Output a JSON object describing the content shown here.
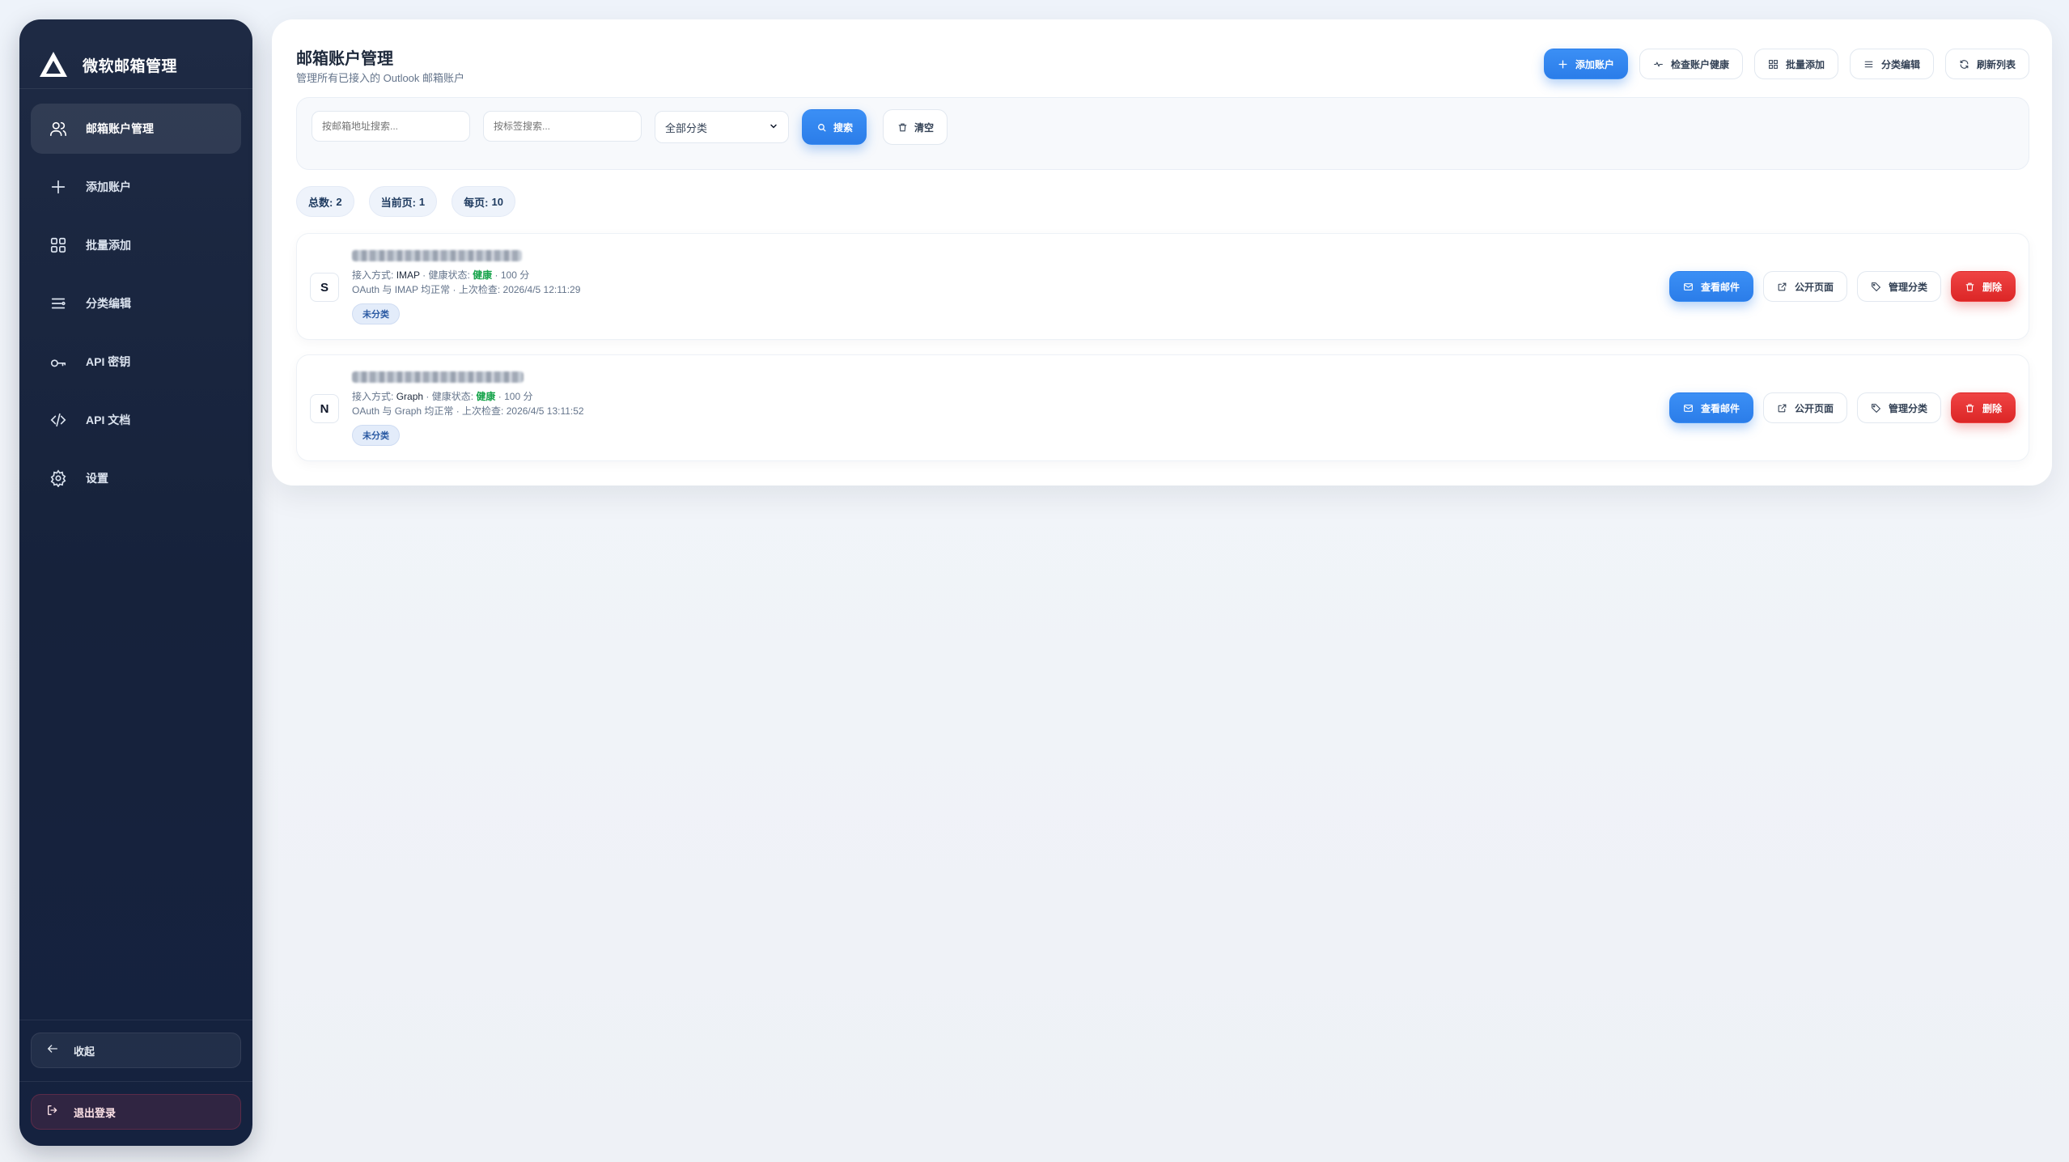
{
  "colors": {
    "accent": "#2b7de9",
    "danger": "#dc2626",
    "sidebar": "#1a2640",
    "healthy": "#16a34a"
  },
  "sidebar": {
    "brand": "微软邮箱管理",
    "items": [
      {
        "label": "邮箱账户管理",
        "icon": "users-icon",
        "active": true
      },
      {
        "label": "添加账户",
        "icon": "plus-icon"
      },
      {
        "label": "批量添加",
        "icon": "grid-icon"
      },
      {
        "label": "分类编辑",
        "icon": "list-icon"
      },
      {
        "label": "API 密钥",
        "icon": "key-icon"
      },
      {
        "label": "API 文档",
        "icon": "code-icon"
      },
      {
        "label": "设置",
        "icon": "gear-icon"
      }
    ],
    "collapse": "收起",
    "logout": "退出登录"
  },
  "header": {
    "title": "邮箱账户管理",
    "subtitle": "管理所有已接入的 Outlook 邮箱账户",
    "actions": {
      "add": "添加账户",
      "check": "检查账户健康",
      "batch": "批量添加",
      "category": "分类编辑",
      "refresh": "刷新列表"
    }
  },
  "filters": {
    "email_placeholder": "按邮箱地址搜索...",
    "tag_placeholder": "按标签搜索...",
    "category_selected": "全部分类",
    "search": "搜索",
    "clear": "清空"
  },
  "stats": {
    "total_label": "总数:",
    "total": "2",
    "page_label": "当前页:",
    "page": "1",
    "per_page_label": "每页:",
    "per_page": "10"
  },
  "accounts": [
    {
      "initial": "S",
      "method_label": "接入方式:",
      "method": "IMAP",
      "health_label": "健康状态:",
      "health": "健康",
      "score": "100 分",
      "status": "OAuth 与 IMAP 均正常",
      "last_check_label": "上次检查:",
      "last_check": "2026/4/5 12:11:29",
      "tag": "未分类"
    },
    {
      "initial": "N",
      "method_label": "接入方式:",
      "method": "Graph",
      "health_label": "健康状态:",
      "health": "健康",
      "score": "100 分",
      "status": "OAuth 与 Graph 均正常",
      "last_check_label": "上次检查:",
      "last_check": "2026/4/5 13:11:52",
      "tag": "未分类"
    }
  ],
  "row_actions": {
    "view": "查看邮件",
    "public": "公开页面",
    "manage": "管理分类",
    "delete": "删除"
  }
}
